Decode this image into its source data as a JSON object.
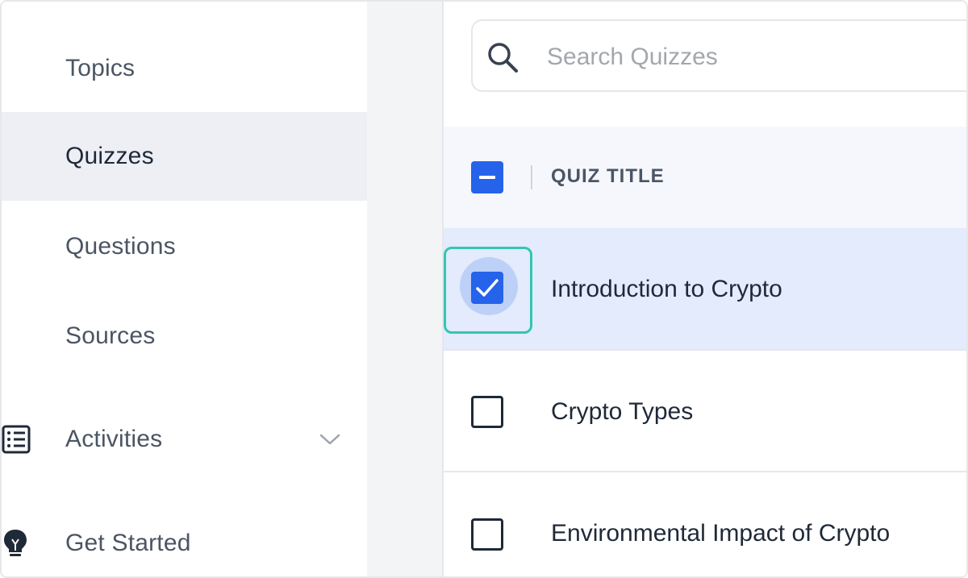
{
  "sidebar": {
    "items": [
      {
        "label": "Topics",
        "active": false
      },
      {
        "label": "Quizzes",
        "active": true
      },
      {
        "label": "Questions",
        "active": false
      },
      {
        "label": "Sources",
        "active": false
      },
      {
        "label": "Activities",
        "icon": "list-icon",
        "expandable": true
      },
      {
        "label": "Get Started",
        "icon": "lightbulb-icon"
      }
    ]
  },
  "search": {
    "placeholder": "Search Quizzes",
    "value": "",
    "icon": "search-icon"
  },
  "table": {
    "header": {
      "select_all_state": "indeterminate",
      "column_title": "QUIZ TITLE"
    },
    "rows": [
      {
        "title": "Introduction to Crypto",
        "checked": true
      },
      {
        "title": "Crypto Types",
        "checked": false
      },
      {
        "title": "Environmental Impact of Crypto",
        "checked": false
      }
    ]
  },
  "colors": {
    "accent": "#2563eb",
    "selected_row": "#e3ebfc",
    "active_nav": "#eeeff5",
    "highlight_outline": "#34c6b0"
  }
}
